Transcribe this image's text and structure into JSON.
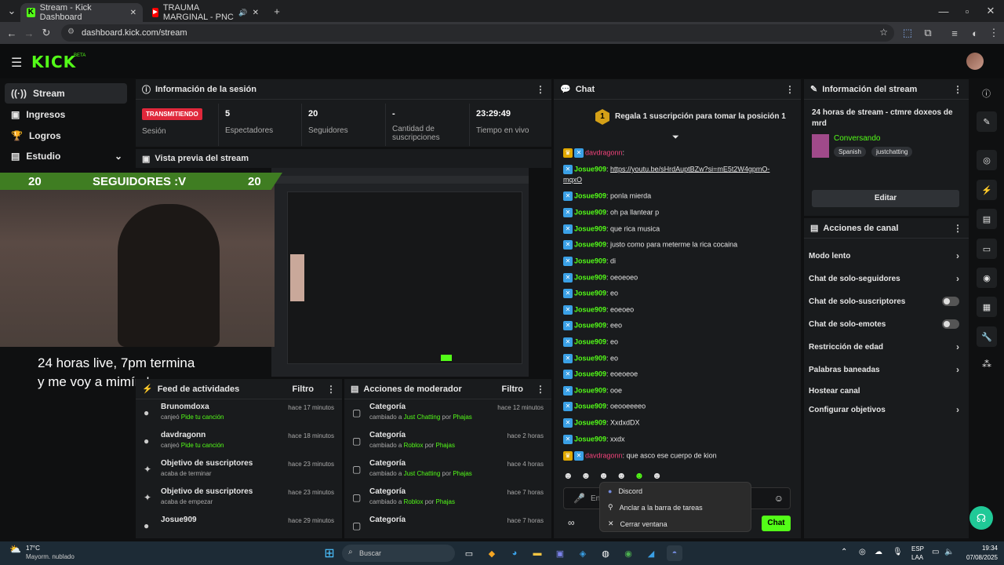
{
  "browser": {
    "tabs": [
      {
        "label": "Stream - Kick Dashboard",
        "active": true
      },
      {
        "label": "TRAUMA MARGINAL - PNC",
        "active": false
      }
    ],
    "url": "dashboard.kick.com/stream"
  },
  "kick": {
    "logo": "KICK",
    "beta": "BETA"
  },
  "sidebar": {
    "items": [
      {
        "label": "Stream",
        "icon": "stream-icon"
      },
      {
        "label": "Ingresos",
        "icon": "wallet-icon"
      },
      {
        "label": "Logros",
        "icon": "trophy-icon"
      },
      {
        "label": "Estudio",
        "icon": "studio-icon"
      }
    ]
  },
  "session": {
    "title": "Información de la sesión",
    "live_badge": "TRANSMITIENDO",
    "session_label": "Sesión",
    "stats": [
      {
        "value": "5",
        "label": "Espectadores"
      },
      {
        "value": "20",
        "label": "Seguidores"
      },
      {
        "value": "-",
        "label": "Cantidad de suscripciones"
      },
      {
        "value": "23:29:49",
        "label": "Tiempo en vivo"
      }
    ]
  },
  "preview": {
    "title": "Vista previa del stream",
    "banner_left": "20",
    "banner_center": "SEGUIDORES :V",
    "banner_right": "20",
    "caption_line1": "24 horas live, 7pm termina",
    "caption_line2": "y me voy a mimír :'v"
  },
  "activity": {
    "title": "Feed de actividades",
    "filter": "Filtro",
    "items": [
      {
        "name": "Brunomdoxa",
        "sub_prefix": "canjeó ",
        "sub_highlight": "Pide tu canción",
        "time": "hace 17 minutos"
      },
      {
        "name": "davdragonn",
        "sub_prefix": "canjeó ",
        "sub_highlight": "Pide tu canción",
        "time": "hace 18 minutos"
      },
      {
        "name": "Objetivo de suscriptores",
        "sub_prefix": "acaba de terminar",
        "sub_highlight": "",
        "time": "hace 23 minutos"
      },
      {
        "name": "Objetivo de suscriptores",
        "sub_prefix": "acaba de empezar",
        "sub_highlight": "",
        "time": "hace 23 minutos"
      },
      {
        "name": "Josue909",
        "sub_prefix": "",
        "sub_highlight": "",
        "time": "hace 29 minutos"
      }
    ]
  },
  "modactions": {
    "title": "Acciones de moderador",
    "filter": "Filtro",
    "items": [
      {
        "name": "Categoría",
        "category": "Just Chatting",
        "by": "Phajas",
        "time": "hace 12 minutos"
      },
      {
        "name": "Categoría",
        "category": "Roblox",
        "by": "Phajas",
        "time": "hace 2 horas"
      },
      {
        "name": "Categoría",
        "category": "Just Chatting",
        "by": "Phajas",
        "time": "hace 4 horas"
      },
      {
        "name": "Categoría",
        "category": "Roblox",
        "by": "Phajas",
        "time": "hace 7 horas"
      },
      {
        "name": "Categoría",
        "category": "",
        "by": "",
        "time": "hace 7 horas"
      }
    ],
    "changed": "cambiado a ",
    "por": " por "
  },
  "chat": {
    "title": "Chat",
    "pin": "Regala 1 suscripción para tomar la posición 1",
    "pin_rank": "1",
    "send": "Chat",
    "input_placeholder": "En",
    "messages": [
      {
        "user": "davdragonn",
        "text": "",
        "style": "red"
      },
      {
        "user": "Josue909",
        "text": "https://youtu.be/sHrdAuptBZw?si=mE5t2W4gpmO-",
        "style": "link"
      },
      {
        "user": "",
        "text": "mqxO",
        "style": "link2"
      },
      {
        "user": "Josue909",
        "text": "ponla mierda"
      },
      {
        "user": "Josue909",
        "text": "oh pa llantear p"
      },
      {
        "user": "Josue909",
        "text": "que rica musica"
      },
      {
        "user": "Josue909",
        "text": "justo como para meterme la rica cocaina"
      },
      {
        "user": "Josue909",
        "text": "di"
      },
      {
        "user": "Josue909",
        "text": "oeoeoeo"
      },
      {
        "user": "Josue909",
        "text": "eo"
      },
      {
        "user": "Josue909",
        "text": "eoeoeo"
      },
      {
        "user": "Josue909",
        "text": "eeo"
      },
      {
        "user": "Josue909",
        "text": "eo"
      },
      {
        "user": "Josue909",
        "text": "eo"
      },
      {
        "user": "Josue909",
        "text": "eoeoeoe"
      },
      {
        "user": "Josue909",
        "text": "ooe"
      },
      {
        "user": "Josue909",
        "text": "oeooeeeeo"
      },
      {
        "user": "Josue909",
        "text": "XxdxdDX"
      },
      {
        "user": "Josue909",
        "text": "xxdx"
      },
      {
        "user": "davdragonn",
        "text": "que asco ese cuerpo de kion",
        "style": "red"
      }
    ]
  },
  "context_menu": {
    "items": [
      {
        "label": "Discord",
        "icon": "discord-icon"
      },
      {
        "label": "Anclar a la barra de tareas",
        "icon": "pin-icon"
      },
      {
        "label": "Cerrar ventana",
        "icon": "close-icon"
      }
    ]
  },
  "stream_info": {
    "title": "Información del stream",
    "stream_title": "24 horas de stream - ctmre doxeos de mrd",
    "category": "Conversando",
    "tags": [
      "Spanish",
      "justchatting"
    ],
    "edit": "Editar"
  },
  "channel_actions": {
    "title": "Acciones de canal",
    "items": [
      {
        "label": "Modo lento",
        "control": "chevron"
      },
      {
        "label": "Chat de solo-seguidores",
        "control": "chevron"
      },
      {
        "label": "Chat de solo-suscriptores",
        "control": "toggle"
      },
      {
        "label": "Chat de solo-emotes",
        "control": "toggle"
      },
      {
        "label": "Restricción de edad",
        "control": "chevron"
      },
      {
        "label": "Palabras baneadas",
        "control": "chevron"
      },
      {
        "label": "Hostear canal",
        "control": "none"
      },
      {
        "label": "Configurar objetivos",
        "control": "chevron"
      }
    ]
  },
  "taskbar": {
    "weather_temp": "17°C",
    "weather_desc": "Mayorm. nublado",
    "search": "Buscar",
    "lang1": "ESP",
    "lang2": "LAA",
    "time": "19:34",
    "date": "07/08/2025"
  },
  "colors": {
    "accent": "#53fc18",
    "live": "#e0283b"
  }
}
